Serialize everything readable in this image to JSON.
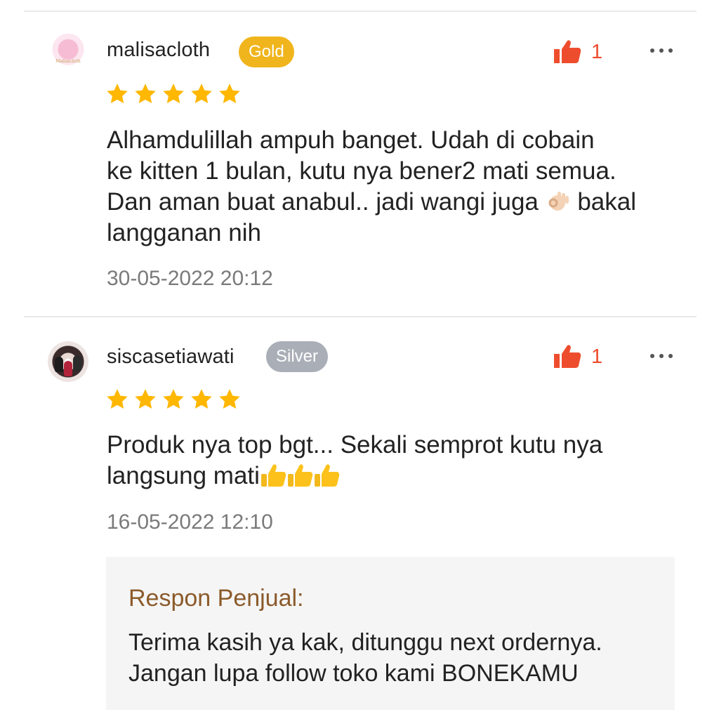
{
  "reviews": [
    {
      "username": "malisacloth",
      "badge": "Gold",
      "avatar_icon": "boutique-logo-avatar",
      "likes": "1",
      "rating": 5,
      "text_lines": [
        "Alhamdulillah ampuh banget. Udah di cobain",
        "ke kitten 1 bulan, kutu nya bener2 mati semua.",
        "Dan aman buat anabul.. jadi wangi juga ",
        "langganan nih"
      ],
      "text_line3_after_emoji": " bakal",
      "emoji": "ok-hand-emoji",
      "date": "30-05-2022 20:12"
    },
    {
      "username": "siscasetiawati",
      "badge": "Silver",
      "avatar_icon": "photo-avatar",
      "likes": "1",
      "rating": 5,
      "text_lines": [
        "Produk nya top bgt... Sekali semprot kutu nya",
        "langsung mati"
      ],
      "emoji": "thumbs-up-emoji",
      "emoji_count": 3,
      "date": "16-05-2022 12:10"
    }
  ],
  "seller_response": {
    "title": "Respon Penjual:",
    "lines": [
      "Terima kasih ya kak, ditunggu next ordernya.",
      "Jangan lupa follow toko kami BONEKAMU"
    ]
  },
  "colors": {
    "accent": "#ee4d2d",
    "star": "#ffb700",
    "gold_badge": "#f0b51c",
    "silver_badge": "#a9aeb7",
    "response_title": "#8b5a2b"
  },
  "icons": [
    "thumbs-up-icon",
    "more-options-icon",
    "star-icon"
  ]
}
